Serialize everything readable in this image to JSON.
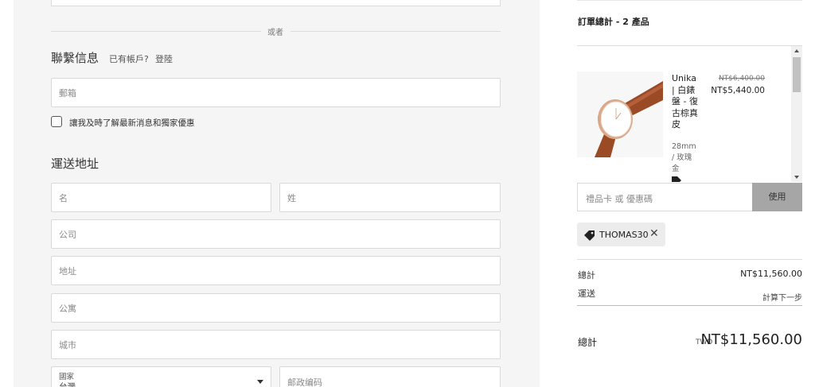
{
  "or_text": "或者",
  "contact": {
    "title": "聯繫信息",
    "have_account": "已有帳戶?",
    "login": "登陸",
    "email_placeholder": "郵箱",
    "newsletter_label": "讓我及時了解最新消息和獨家優惠"
  },
  "shipping": {
    "title": "運送地址",
    "first_name_placeholder": "名",
    "last_name_placeholder": "姓",
    "company_placeholder": "公司",
    "address_placeholder": "地址",
    "apartment_placeholder": "公寓",
    "city_placeholder": "城市",
    "country_label": "國家",
    "country_value": "台灣",
    "postal_placeholder": "邮政编码"
  },
  "summary": {
    "title": "訂單總計 - 2 產品",
    "item": {
      "name": "Unika | 白錶盤 - 復古棕真皮",
      "variant": "28mm / 玫瑰金",
      "price_original": "NT$6,400.00",
      "price_current": "NT$5,440.00"
    },
    "discount_placeholder": "禮品卡 或 優惠碼",
    "apply_label": "使用",
    "discount_code": "THOMAS30",
    "subtotal_label": "總計",
    "subtotal_value": "NT$11,560.00",
    "shipping_label": "運送",
    "shipping_value": "計算下一步",
    "total_label": "總計",
    "total_currency": "TWD",
    "total_value": "NT$11,560.00"
  }
}
